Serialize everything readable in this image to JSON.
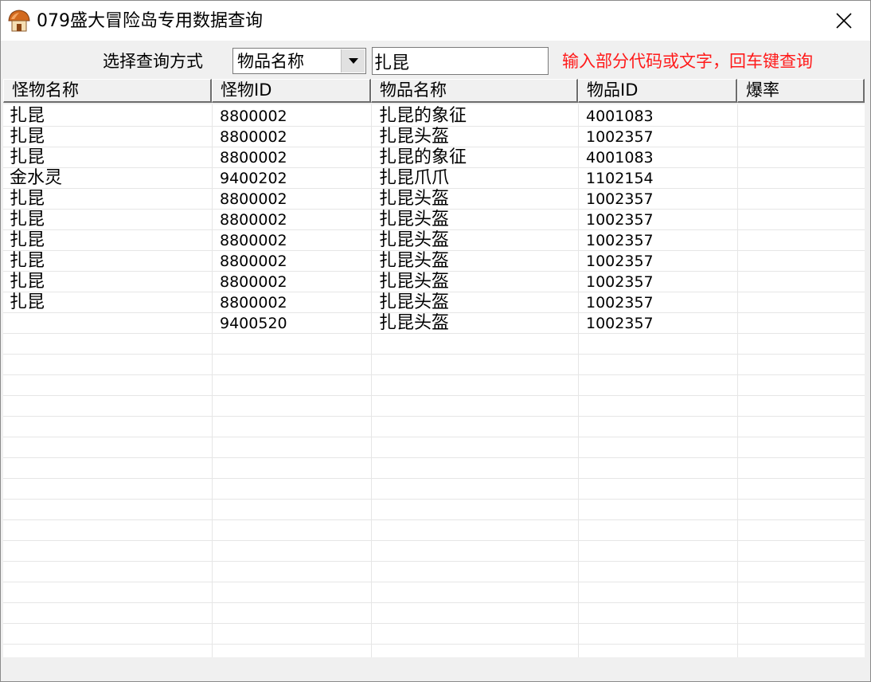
{
  "window": {
    "title": "079盛大冒险岛专用数据查询",
    "app_icon": "mushroom-house-icon",
    "close_icon": "close-icon"
  },
  "query": {
    "label": "选择查询方式",
    "select_value": "物品名称",
    "search_value": "扎昆",
    "hint": "输入部分代码或文字，回车键查询",
    "hint_color": "#ff1a1a"
  },
  "table": {
    "columns": [
      "怪物名称",
      "怪物ID",
      "物品名称",
      "物品ID",
      "爆率"
    ],
    "rows": [
      {
        "monster_name": "扎昆",
        "monster_id": "8800002",
        "item_name": "扎昆的象征",
        "item_id": "4001083",
        "drop_rate": ""
      },
      {
        "monster_name": "扎昆",
        "monster_id": "8800002",
        "item_name": "扎昆头盔",
        "item_id": "1002357",
        "drop_rate": ""
      },
      {
        "monster_name": "扎昆",
        "monster_id": "8800002",
        "item_name": "扎昆的象征",
        "item_id": "4001083",
        "drop_rate": ""
      },
      {
        "monster_name": "金水灵",
        "monster_id": "9400202",
        "item_name": "扎昆爪爪",
        "item_id": "1102154",
        "drop_rate": ""
      },
      {
        "monster_name": "扎昆",
        "monster_id": "8800002",
        "item_name": "扎昆头盔",
        "item_id": "1002357",
        "drop_rate": ""
      },
      {
        "monster_name": "扎昆",
        "monster_id": "8800002",
        "item_name": "扎昆头盔",
        "item_id": "1002357",
        "drop_rate": ""
      },
      {
        "monster_name": "扎昆",
        "monster_id": "8800002",
        "item_name": "扎昆头盔",
        "item_id": "1002357",
        "drop_rate": ""
      },
      {
        "monster_name": "扎昆",
        "monster_id": "8800002",
        "item_name": "扎昆头盔",
        "item_id": "1002357",
        "drop_rate": ""
      },
      {
        "monster_name": "扎昆",
        "monster_id": "8800002",
        "item_name": "扎昆头盔",
        "item_id": "1002357",
        "drop_rate": ""
      },
      {
        "monster_name": "扎昆",
        "monster_id": "8800002",
        "item_name": "扎昆头盔",
        "item_id": "1002357",
        "drop_rate": ""
      },
      {
        "monster_name": "",
        "monster_id": "9400520",
        "item_name": "扎昆头盔",
        "item_id": "1002357",
        "drop_rate": ""
      }
    ]
  }
}
